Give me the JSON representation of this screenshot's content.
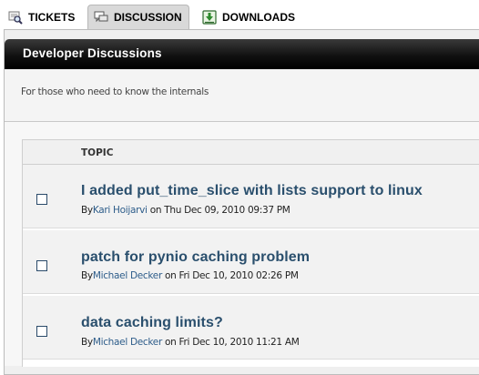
{
  "tabs": [
    {
      "label": "TICKETS",
      "icon": "ticket-search-icon"
    },
    {
      "label": "DISCUSSION",
      "icon": "chat-bubbles-icon",
      "active": true
    },
    {
      "label": "DOWNLOADS",
      "icon": "download-icon"
    }
  ],
  "forum": {
    "title": "Developer Discussions",
    "description": "For those who need to know the internals"
  },
  "table": {
    "column_topic": "TOPIC",
    "rows": [
      {
        "title": "I added put_time_slice with lists support to linux",
        "by": "By",
        "author": "Kari Hoijarvi",
        "on": "on Thu Dec 09, 2010 09:37 PM"
      },
      {
        "title": "patch for pynio caching problem",
        "by": "By",
        "author": "Michael Decker",
        "on": "on Fri Dec 10, 2010 02:26 PM"
      },
      {
        "title": "data caching limits?",
        "by": "By",
        "author": "Michael Decker",
        "on": "on Fri Dec 10, 2010 11:21 AM"
      }
    ]
  },
  "colors": {
    "header_black": "#000000",
    "link_blue": "#2a4f6d",
    "author_blue": "#2e5d8a",
    "tab_active_bg": "#d9d9d9"
  }
}
